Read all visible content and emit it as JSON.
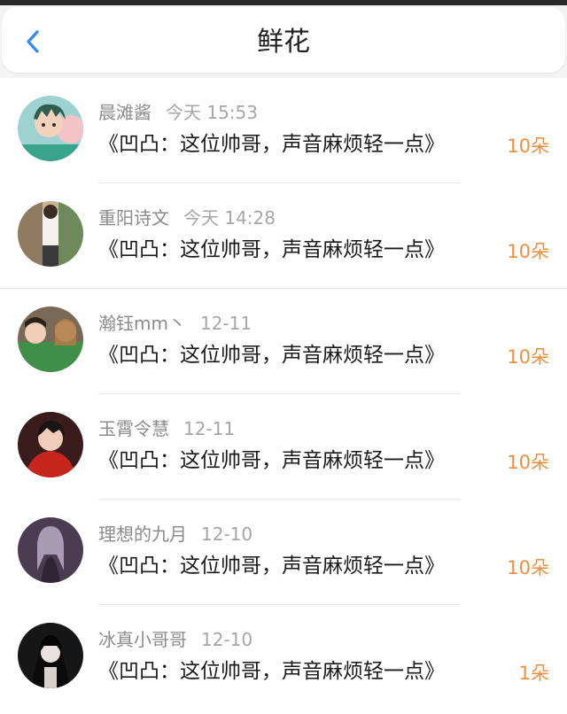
{
  "header": {
    "title": "鲜花",
    "back_icon": "chevron-left-icon",
    "accent_color": "#2f8cff"
  },
  "flowers": [
    {
      "nickname": "晨滩酱",
      "time": "今天 15:53",
      "comment": "《凹凸：这位帅哥，声音麻烦轻一点》",
      "count": "10朵"
    },
    {
      "nickname": "重阳诗文",
      "time": "今天 14:28",
      "comment": "《凹凸：这位帅哥，声音麻烦轻一点》",
      "count": "10朵"
    },
    {
      "nickname": "瀚钰mm丶",
      "time": "12-11",
      "comment": "《凹凸：这位帅哥，声音麻烦轻一点》",
      "count": "10朵"
    },
    {
      "nickname": "玉霄令慧",
      "time": "12-11",
      "comment": "《凹凸：这位帅哥，声音麻烦轻一点》",
      "count": "10朵"
    },
    {
      "nickname": "理想的九月",
      "time": "12-10",
      "comment": "《凹凸：这位帅哥，声音麻烦轻一点》",
      "count": "10朵"
    },
    {
      "nickname": "冰真小哥哥",
      "time": "12-10",
      "comment": "《凹凸：这位帅哥，声音麻烦轻一点》",
      "count": "1朵"
    }
  ]
}
